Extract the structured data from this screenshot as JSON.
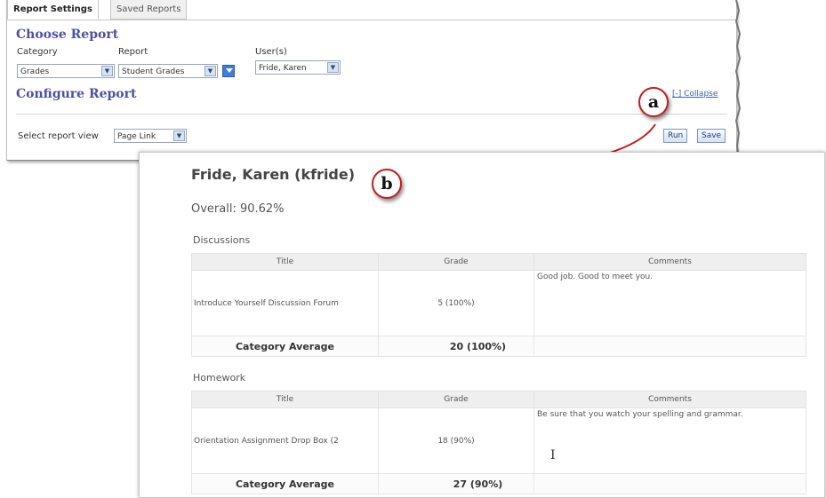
{
  "settings": {
    "tabs": [
      "Report Settings",
      "Saved Reports"
    ],
    "choose_title": "Choose Report",
    "category_label": "Category",
    "category_value": "Grades",
    "report_label": "Report",
    "report_value": "Student Grades",
    "users_label": "User(s)",
    "users_value": "Fride, Karen",
    "configure_title": "Configure Report",
    "collapse_link": "[-] Collapse",
    "view_label": "Select report view",
    "view_value": "Page Link",
    "run_button": "Run",
    "save_button": "Save"
  },
  "callouts": {
    "a": "a",
    "b": "b"
  },
  "report": {
    "student_name": "Fride, Karen (kfride)",
    "overall": "Overall: 90.62%",
    "columns": [
      "Title",
      "Grade",
      "Comments"
    ],
    "categories": [
      {
        "name": "Discussions",
        "rows": [
          {
            "title": "Introduce Yourself Discussion Forum",
            "grade": "5 (100%)",
            "comments": "Good job. Good to meet you."
          }
        ],
        "average_label": "Category Average",
        "average_value": "20 (100%)"
      },
      {
        "name": "Homework",
        "rows": [
          {
            "title": "Orientation Assignment Drop Box (2",
            "grade": "18 (90%)",
            "comments": "Be sure that you watch your spelling and grammar."
          }
        ],
        "average_label": "Category Average",
        "average_value": "27 (90%)"
      }
    ]
  },
  "colors": {
    "section_title": "#4f4fa5",
    "callout_border": "#c21d1d",
    "arrow": "#c21d1d",
    "link": "#3a5fb0"
  },
  "icons": {
    "dropdown": "chevron-down-icon",
    "expand": "expand-icon",
    "cursor": "text-cursor-icon"
  }
}
